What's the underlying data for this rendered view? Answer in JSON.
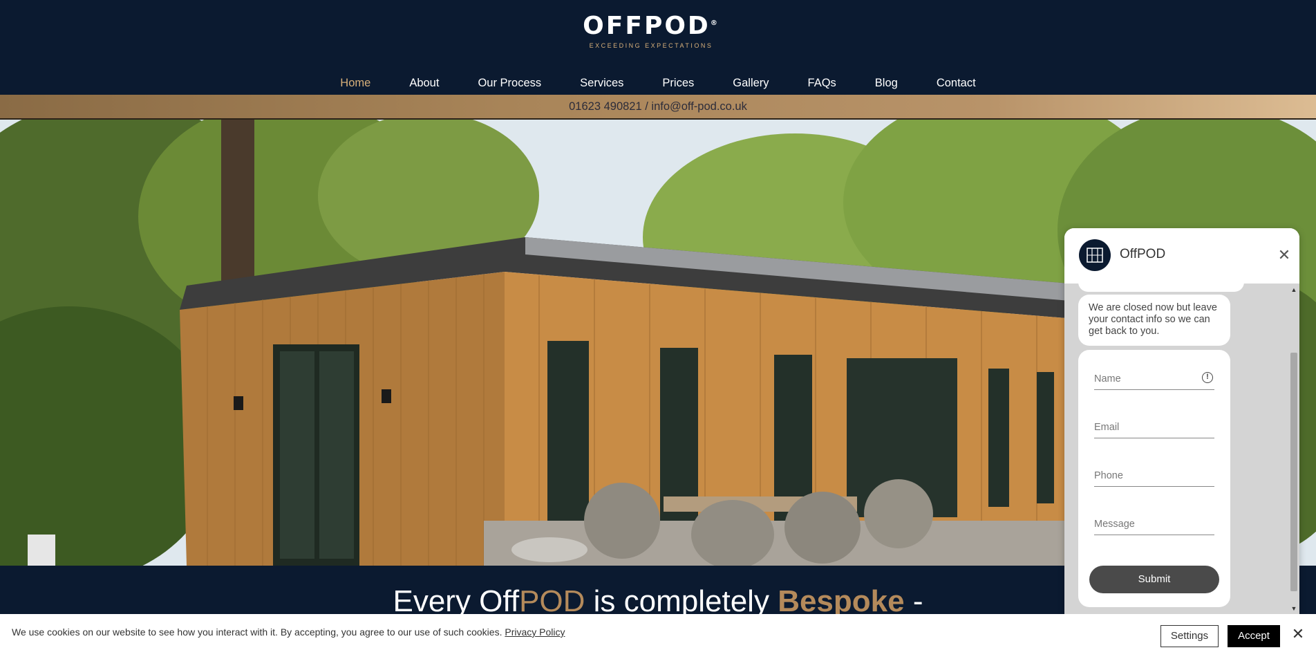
{
  "header": {
    "logo_word": "OFFPOD",
    "logo_reg": "®",
    "logo_tagline": "EXCEEDING EXPECTATIONS"
  },
  "nav": {
    "items": [
      {
        "label": "Home",
        "active": true
      },
      {
        "label": "About",
        "active": false
      },
      {
        "label": "Our Process",
        "active": false
      },
      {
        "label": "Services",
        "active": false
      },
      {
        "label": "Prices",
        "active": false
      },
      {
        "label": "Gallery",
        "active": false
      },
      {
        "label": "FAQs",
        "active": false
      },
      {
        "label": "Blog",
        "active": false
      },
      {
        "label": "Contact",
        "active": false
      }
    ]
  },
  "contact_strip": {
    "text": "01623 490821 / info@off-pod.co.uk"
  },
  "headline": {
    "part1": "Every Off",
    "part2": "POD",
    "part3": " is completely ",
    "part4": "Bespoke",
    "part5": " -"
  },
  "chat": {
    "title": "OffPOD",
    "message": "We are closed now but leave your contact info so we can get back to you.",
    "name_placeholder": "Name",
    "email_placeholder": "Email",
    "phone_placeholder": "Phone",
    "message_placeholder": "Message",
    "submit_label": "Submit",
    "close_icon": "close-icon"
  },
  "cookie": {
    "text": "We use cookies on our website to see how you interact with it. By accepting, you agree to our use of such cookies. ",
    "link": "Privacy Policy",
    "settings_label": "Settings",
    "accept_label": "Accept"
  },
  "colors": {
    "navy": "#0b1a30",
    "gold": "#b48a5b",
    "nav_active": "#d8b07a"
  }
}
